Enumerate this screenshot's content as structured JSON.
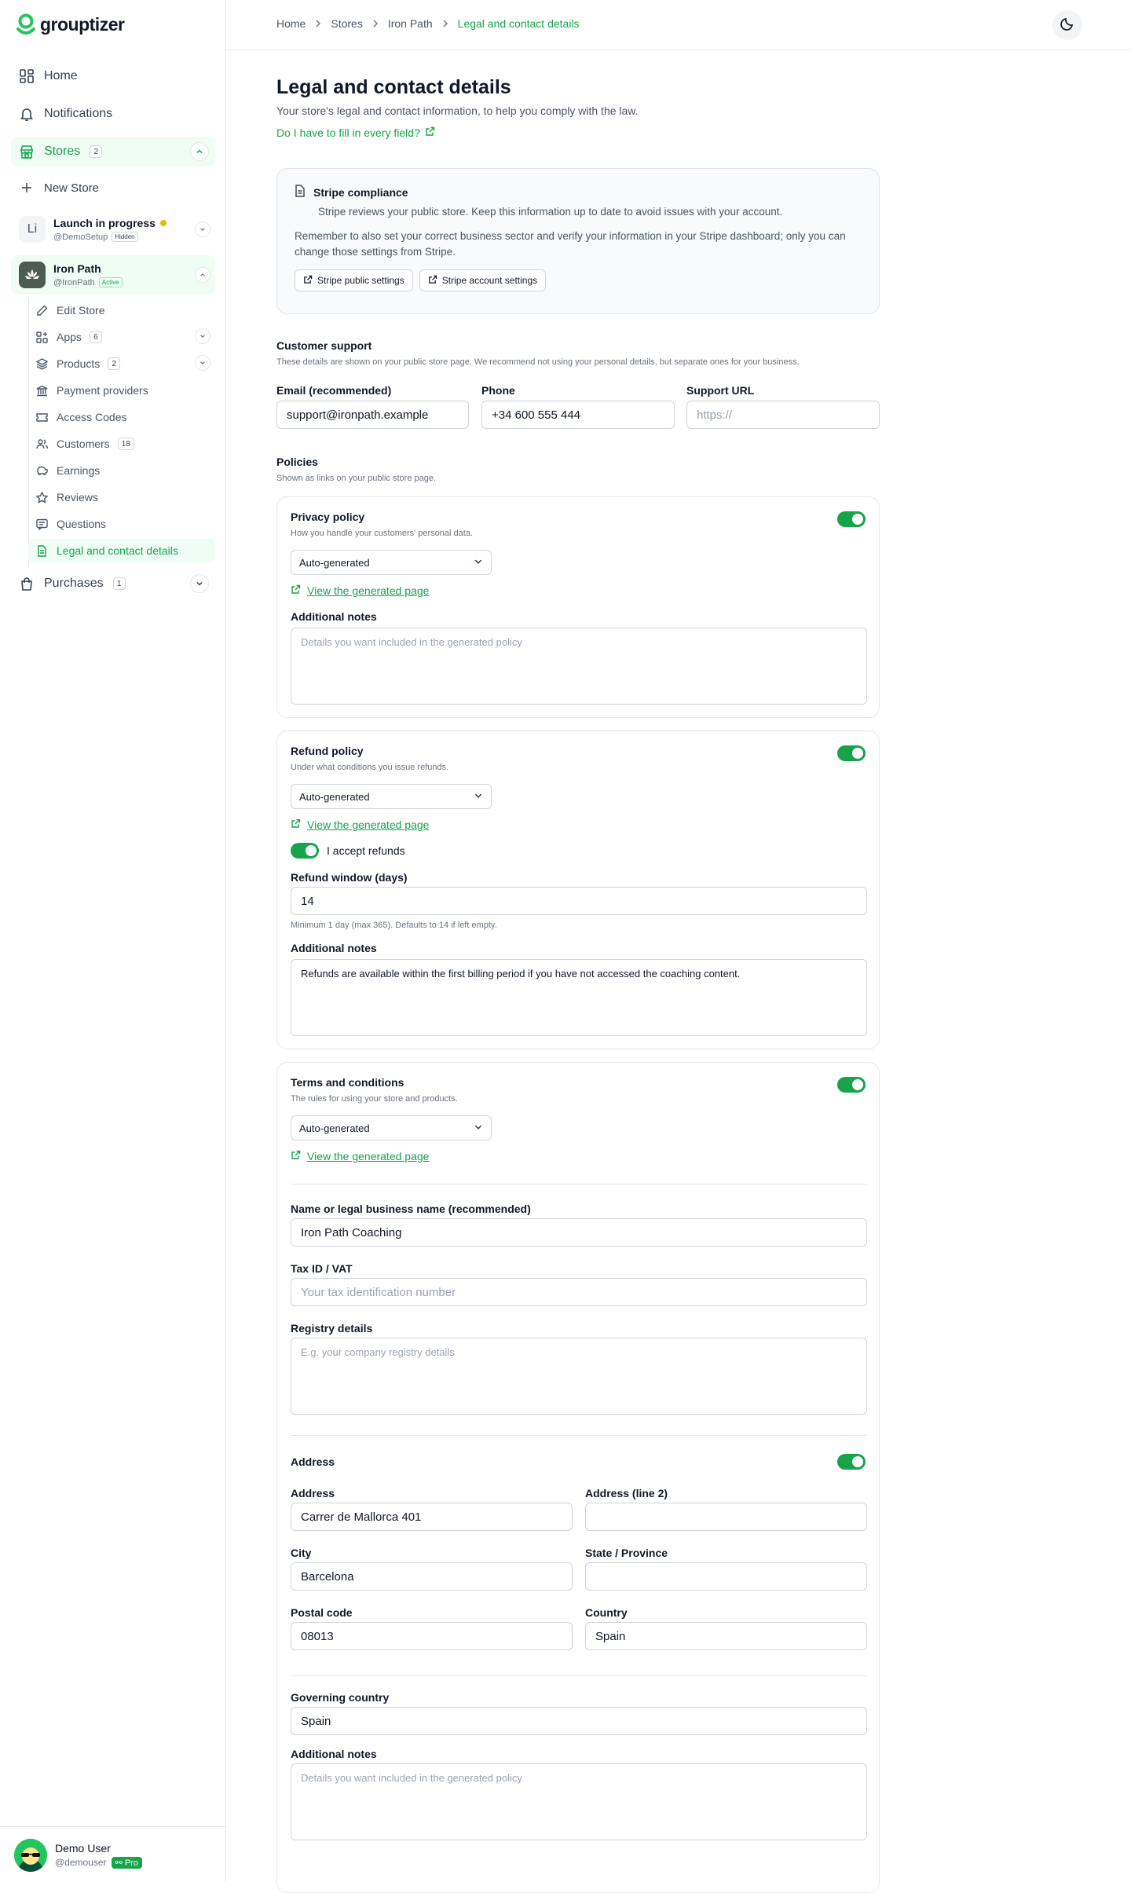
{
  "app": {
    "name": "grouptizer"
  },
  "sidebar": {
    "home": "Home",
    "notifications": "Notifications",
    "stores": {
      "label": "Stores",
      "count": "2"
    },
    "new_store": "New Store",
    "store1": {
      "initials": "Li",
      "name": "Launch in progress",
      "handle": "@DemoSetup",
      "tag": "Hidden"
    },
    "store2": {
      "name": "Iron Path",
      "handle": "@IronPath",
      "tag": "Active"
    },
    "sub": {
      "edit_store": "Edit Store",
      "apps": {
        "label": "Apps",
        "count": "6"
      },
      "products": {
        "label": "Products",
        "count": "2"
      },
      "payment_providers": "Payment providers",
      "access_codes": "Access Codes",
      "customers": {
        "label": "Customers",
        "count": "18"
      },
      "earnings": "Earnings",
      "reviews": "Reviews",
      "questions": "Questions",
      "legal": "Legal and contact details"
    },
    "purchases": {
      "label": "Purchases",
      "count": "1"
    },
    "user": {
      "name": "Demo User",
      "handle": "@demouser",
      "plan": "Pro"
    }
  },
  "breadcrumb": [
    "Home",
    "Stores",
    "Iron Path",
    "Legal and contact details"
  ],
  "page": {
    "title": "Legal and contact details",
    "subtitle": "Your store's legal and contact information, to help you comply with the law.",
    "help_link": "Do I have to fill in every field?"
  },
  "stripe": {
    "title": "Stripe compliance",
    "desc": "Stripe reviews your public store. Keep this information up to date to avoid issues with your account.",
    "reminder": "Remember to also set your correct business sector and verify your information in your Stripe dashboard; only you can change those settings from Stripe.",
    "btn_public": "Stripe public settings",
    "btn_account": "Stripe account settings"
  },
  "support": {
    "title": "Customer support",
    "desc": "These details are shown on your public store page. We recommend not using your personal details, but separate ones for your business.",
    "email_label": "Email (recommended)",
    "email_value": "support@ironpath.example",
    "phone_label": "Phone",
    "phone_value": "+34 600 555 444",
    "url_label": "Support URL",
    "url_placeholder": "https://"
  },
  "policies": {
    "title": "Policies",
    "desc": "Shown as links on your public store page.",
    "view_link": "View the generated page",
    "mode": "Auto-generated",
    "notes_label": "Additional notes",
    "notes_placeholder": "Details you want included in the generated policy",
    "privacy": {
      "title": "Privacy policy",
      "desc": "How you handle your customers' personal data."
    },
    "refund": {
      "title": "Refund policy",
      "desc": "Under what conditions you issue refunds.",
      "accept": "I accept refunds",
      "window_label": "Refund window (days)",
      "window_value": "14",
      "window_hint": "Minimum 1 day (max 365). Defaults to 14 if left empty.",
      "notes_value": "Refunds are available within the first billing period if you have not accessed the coaching content."
    },
    "terms": {
      "title": "Terms and conditions",
      "desc": "The rules for using your store and products.",
      "name_label": "Name or legal business name (recommended)",
      "name_value": "Iron Path Coaching",
      "tax_label": "Tax ID / VAT",
      "tax_placeholder": "Your tax identification number",
      "registry_label": "Registry details",
      "registry_placeholder": "E.g. your company registry details",
      "address_title": "Address",
      "addr1_label": "Address",
      "addr1_value": "Carrer de Mallorca 401",
      "addr2_label": "Address (line 2)",
      "city_label": "City",
      "city_value": "Barcelona",
      "state_label": "State / Province",
      "postal_label": "Postal code",
      "postal_value": "08013",
      "country_label": "Country",
      "country_value": "Spain",
      "gov_label": "Governing country",
      "gov_value": "Spain"
    }
  }
}
